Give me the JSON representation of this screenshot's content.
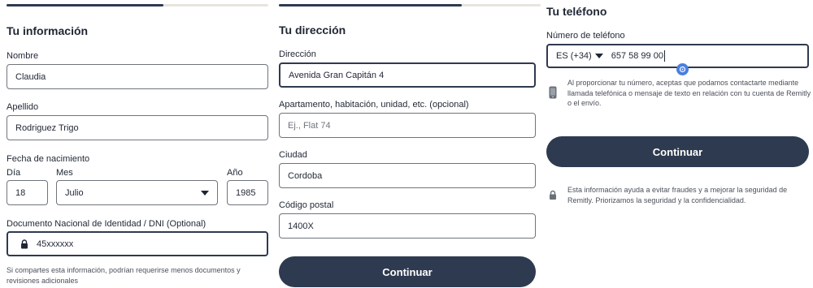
{
  "info": {
    "title": "Tu información",
    "progress": 0.6,
    "first_name": {
      "label": "Nombre",
      "value": "Claudia"
    },
    "last_name": {
      "label": "Apellido",
      "value": "Rodriguez Trigo"
    },
    "birth": {
      "label": "Fecha de nacimiento",
      "day_label": "Día",
      "day_value": "18",
      "month_label": "Mes",
      "month_value": "Julio",
      "year_label": "Año",
      "year_value": "1985"
    },
    "dni": {
      "label": "Documento Nacional de Identidad / DNI (Optional)",
      "value": "45xxxxxx"
    },
    "note": "Si compartes esta información, podrían requerirse menos documentos y revisiones adicionales"
  },
  "address": {
    "title": "Tu dirección",
    "progress": 0.7,
    "street": {
      "label": "Dirección",
      "value": "Avenida Gran Capitán 4"
    },
    "apartment": {
      "label": "Apartamento, habitación, unidad, etc. (opcional)",
      "placeholder": "Ej., Flat 74"
    },
    "city": {
      "label": "Ciudad",
      "value": "Cordoba"
    },
    "postal": {
      "label": "Código postal",
      "value": "1400X"
    },
    "continue_label": "Continuar"
  },
  "phone": {
    "title": "Tu teléfono",
    "number_label": "Número de teléfono",
    "country_code": "ES (+34)",
    "number_value": "657 58 99 00",
    "consent_text": "Al proporcionar tu número, aceptas que podamos contactarte mediante llamada telefónica o mensaje de texto en relación con tu cuenta de Remitly o el envío.",
    "continue_label": "Continuar",
    "security_text": "Esta información ayuda a evitar fraudes y a mejorar la seguridad de Remitly. Priorizamos la seguridad y la confidencialidad."
  },
  "colors": {
    "primary": "#2e3a4f",
    "accent_blue": "#4a7fe0",
    "border": "#6f747c",
    "track": "#e8e4df"
  },
  "icons": [
    "lock-icon",
    "chevron-down-icon",
    "phone-icon",
    "key-icon"
  ]
}
